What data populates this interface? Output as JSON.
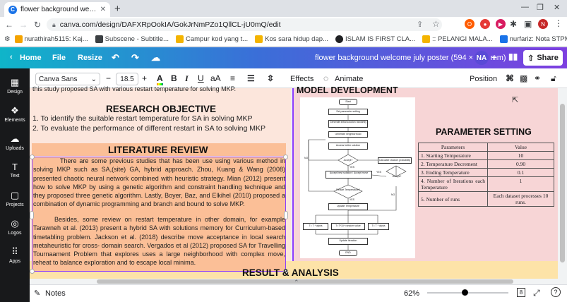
{
  "browser": {
    "tab_title": "flower background welcome july",
    "url": "canva.com/design/DAFXRpOokIA/GokJrNmPZo1QllCL-jU0mQ/edit",
    "bookmarks": [
      {
        "label": "nurathirah5115: Kaj...",
        "color": "#ea4335"
      },
      {
        "label": "Subscene - Subtitle...",
        "color": "#3c4043"
      },
      {
        "label": "Campur kod yang t...",
        "color": "#f4b400"
      },
      {
        "label": "Kos sara hidup dap...",
        "color": "#f4b400"
      },
      {
        "label": "ISLAM IS FIRST CLA...",
        "color": "#202124"
      },
      {
        "label": ":: PELANGI MALA...",
        "color": "#f4b400"
      },
      {
        "label": "nurfariz: Nota STPM",
        "color": "#1a73e8"
      }
    ]
  },
  "canva_top": {
    "home": "Home",
    "file": "File",
    "resize": "Resize",
    "doc_title": "flower background welcome july poster (594 × 841 mm)",
    "avatar_initials": "NA",
    "share": "Share"
  },
  "sidebar": [
    {
      "label": "Design",
      "glyph": "▦"
    },
    {
      "label": "Elements",
      "glyph": "❖"
    },
    {
      "label": "Uploads",
      "glyph": "☁"
    },
    {
      "label": "Text",
      "glyph": "T"
    },
    {
      "label": "Projects",
      "glyph": "▢"
    },
    {
      "label": "Logos",
      "glyph": "◎"
    },
    {
      "label": "Apps",
      "glyph": "⠿"
    }
  ],
  "toolbar": {
    "font": "Canva Sans",
    "size": "18.5",
    "effects": "Effects",
    "animate": "Animate",
    "position": "Position"
  },
  "poster": {
    "top_cut_text": "this study proposed SA with various restart temperature for solving MKP.",
    "research_objective_title": "RESEARCH OBJECTIVE",
    "objective_1": "1. To identify the suitable restart temperature for SA in solving MKP",
    "objective_2": "2. To evaluate the performance of different restart in SA to solving MKP",
    "literature_title": "LITERATURE REVIEW",
    "lit_para_1": "There are some previous studies that has been use using various method in solving MKP such as SA,(site) GA, hybrid approach. Zhou, Kuang & Wang (2008) presented chaotic neural network combined with heuristic strategy. Mian (2012) present how to solve MKP by using a genetic algorithm and constraint handling technique and they proposed three genetic algorithm. Lastly, Boyer, Baz, and Elkihel (2010) proposed a combination of dynamic programming and branch and bound to solve MKP.",
    "lit_para_2": "Besides, some review on restart temperature in other domain, for example Tarawneh et al. (2013) present a hybrid SA with solutions memory for Curriculum-based timetabling problem. Jackson et al. (2018) describe move acceptance in local search metaheuristic for cross- domain search. Vergados et al (2012) proposed SA for Travelling Tournaament Problem that explores uses a large neighborhood with complex move, reheat to balance exploration and to escape local minima.",
    "model_title": "MODEL DEVELOPMENT",
    "param_title": "PARAMETER SETTING",
    "result_title": "RESULT & ANALYSIS",
    "param_headers": [
      "Parameters",
      "Value"
    ],
    "param_rows": [
      [
        "1.  Starting Temperature",
        "10"
      ],
      [
        "2.  Temperature Decrement",
        "0.90"
      ],
      [
        "3.  Ending Temperature",
        "0.1"
      ],
      [
        "4.  Number of Iterations each Temperature",
        "1"
      ],
      [
        "5.  Number of runs",
        "Each dataset processes 10 runs."
      ]
    ],
    "flow": {
      "start": "Start",
      "s1": "Set parameter setting",
      "s2": "Generate initial solution randomly",
      "s3": "Generate neighborhood",
      "s4": "Access better solution",
      "d1": "Accept?",
      "calc": "Calculate random probability",
      "s5": "Accept best solution / Accept move",
      "d2": "Accept?",
      "d3": "Restart Temperature?",
      "s6": "Update Temperature",
      "r1": "T= T * alpha",
      "r2": "T=T*10^ random value",
      "r3": "T= T * alpha",
      "s7": "Update Iteration",
      "end": "END",
      "yes": "YES",
      "no": "NO"
    }
  },
  "footer": {
    "notes": "Notes",
    "zoom": "62%",
    "page_num": "8"
  }
}
